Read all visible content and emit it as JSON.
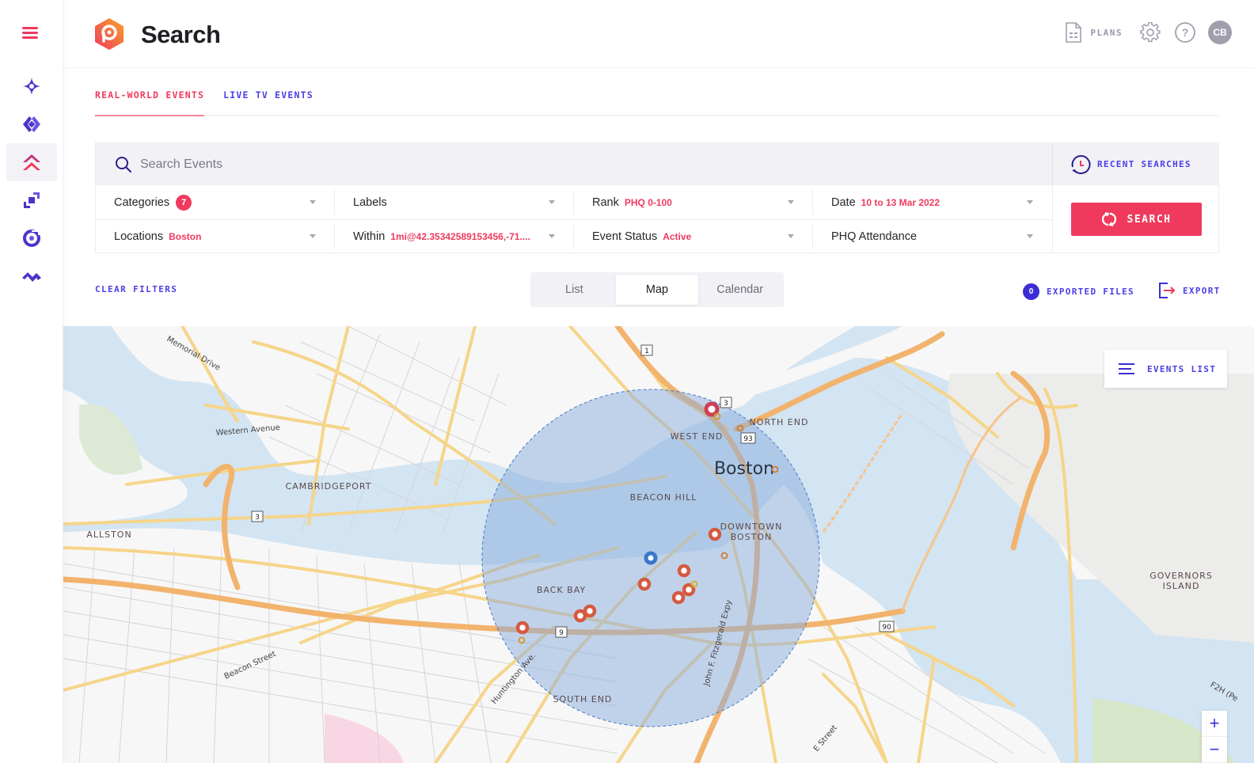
{
  "app": {
    "title": "Search",
    "brand_color": "#ef3a5d",
    "accent_color": "#4b3ee6"
  },
  "sidebar": {
    "menu_icon": "hamburger-menu-icon",
    "items": [
      {
        "icon": "sparkle-star-icon",
        "active": false
      },
      {
        "icon": "diamond-nodes-icon",
        "active": false
      },
      {
        "icon": "double-chevron-up-icon",
        "active": true
      },
      {
        "icon": "stacked-squares-icon",
        "active": false
      },
      {
        "icon": "target-ring-icon",
        "active": false
      },
      {
        "icon": "zigzag-wave-icon",
        "active": false
      }
    ]
  },
  "header": {
    "plans_label": "PLANS",
    "settings_icon": "gear-icon",
    "help_icon": "help-icon",
    "avatar_initials": "CB"
  },
  "tabs": [
    {
      "label": "REAL-WORLD EVENTS",
      "active": true
    },
    {
      "label": "LIVE TV EVENTS",
      "active": false
    }
  ],
  "search": {
    "placeholder": "Search Events",
    "value": "",
    "recent_label": "RECENT SEARCHES",
    "button_label": "SEARCH"
  },
  "filters": [
    {
      "label": "Categories",
      "badge": "7",
      "value": ""
    },
    {
      "label": "Labels",
      "value": ""
    },
    {
      "label": "Rank",
      "value": "PHQ 0-100"
    },
    {
      "label": "Date",
      "value": "10 to 13 Mar 2022"
    },
    {
      "label": "Locations",
      "value": "Boston"
    },
    {
      "label": "Within",
      "value": "1mi@42.35342589153456,-71...."
    },
    {
      "label": "Event Status",
      "value": "Active"
    },
    {
      "label": "PHQ Attendance",
      "value": ""
    }
  ],
  "toolbar": {
    "clear_filters": "CLEAR FILTERS",
    "views": [
      {
        "label": "List",
        "active": false
      },
      {
        "label": "Map",
        "active": true
      },
      {
        "label": "Calendar",
        "active": false
      }
    ],
    "exported_count": "0",
    "exported_label": "EXPORTED FILES",
    "export_label": "EXPORT"
  },
  "map": {
    "events_list_label": "EVENTS LIST",
    "zoom_in": "+",
    "zoom_out": "−",
    "city_label": "Boston",
    "area_labels": [
      "WEST END",
      "NORTH END",
      "BEACON HILL",
      "DOWNTOWN",
      "BOSTON",
      "BACK BAY",
      "SOUTH END",
      "CAMBRIDGEPORT",
      "ALLSTON",
      "GOVERNORS",
      "ISLAND"
    ],
    "street_labels": [
      "Memorial Drive",
      "Western Avenue",
      "Beacon Street",
      "Huntington Ave.",
      "John F. Fitzgerald Expy",
      "E Street",
      "F2H (Pe"
    ],
    "route_shields": [
      "1",
      "3",
      "93",
      "3",
      "9",
      "90"
    ],
    "search_radius": "1mi",
    "center": {
      "lat": 42.35342589153456,
      "lng": -71.0
    }
  }
}
